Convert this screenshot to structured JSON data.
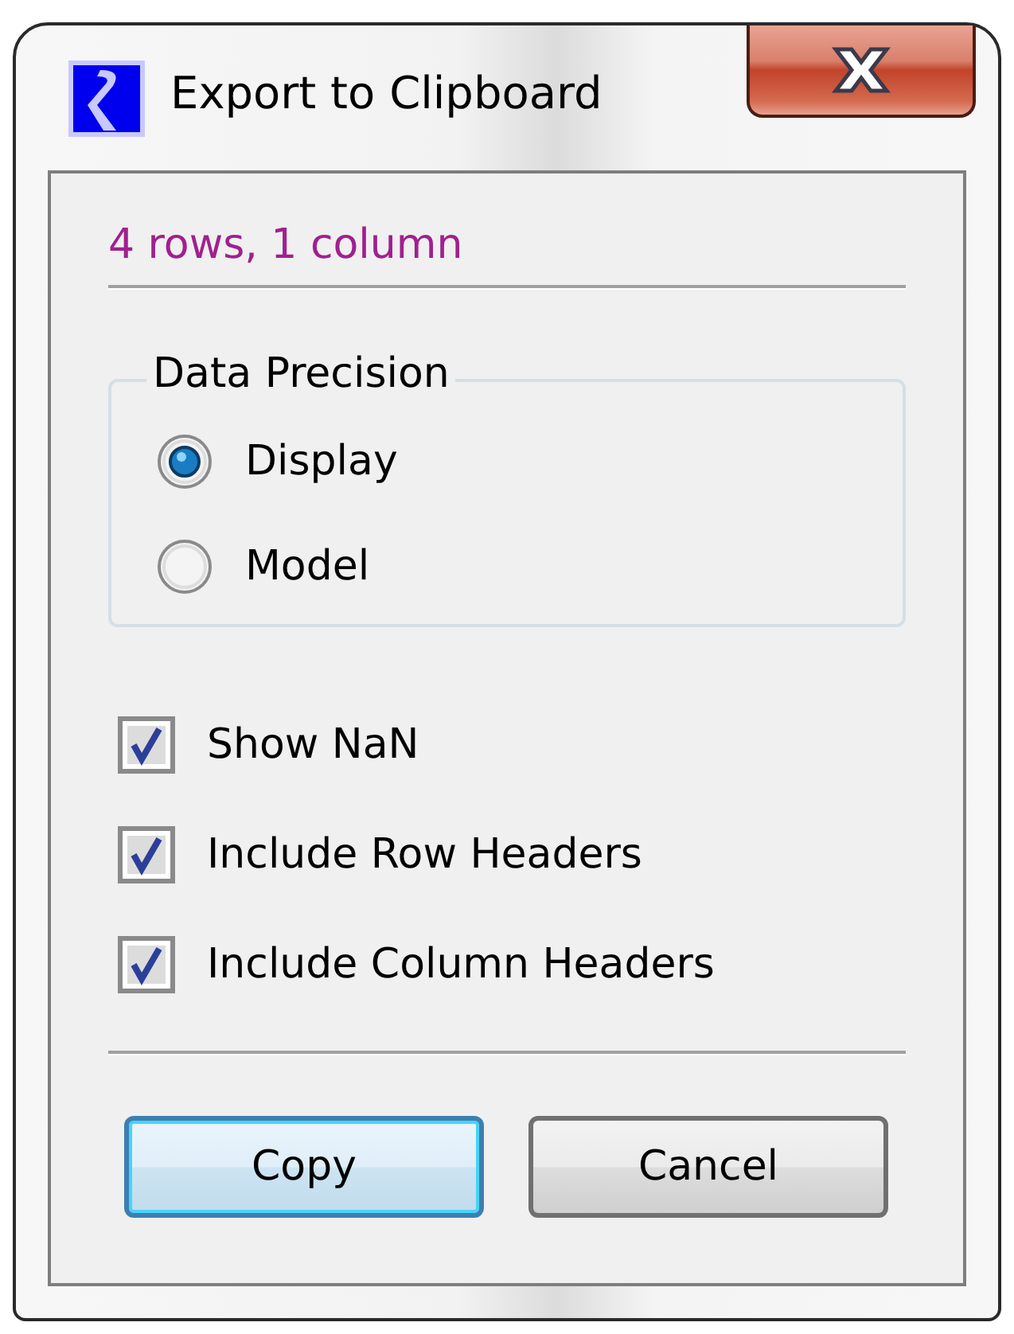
{
  "window": {
    "title": "Export to Clipboard"
  },
  "summary": "4 rows, 1 column",
  "precision": {
    "title": "Data Precision",
    "options": [
      {
        "label": "Display",
        "selected": true
      },
      {
        "label": "Model",
        "selected": false
      }
    ]
  },
  "options": [
    {
      "label": "Show NaN",
      "checked": true
    },
    {
      "label": "Include Row Headers",
      "checked": true
    },
    {
      "label": "Include Column Headers",
      "checked": true
    }
  ],
  "buttons": [
    {
      "label": "Copy",
      "default": true
    },
    {
      "label": "Cancel",
      "default": false
    }
  ]
}
